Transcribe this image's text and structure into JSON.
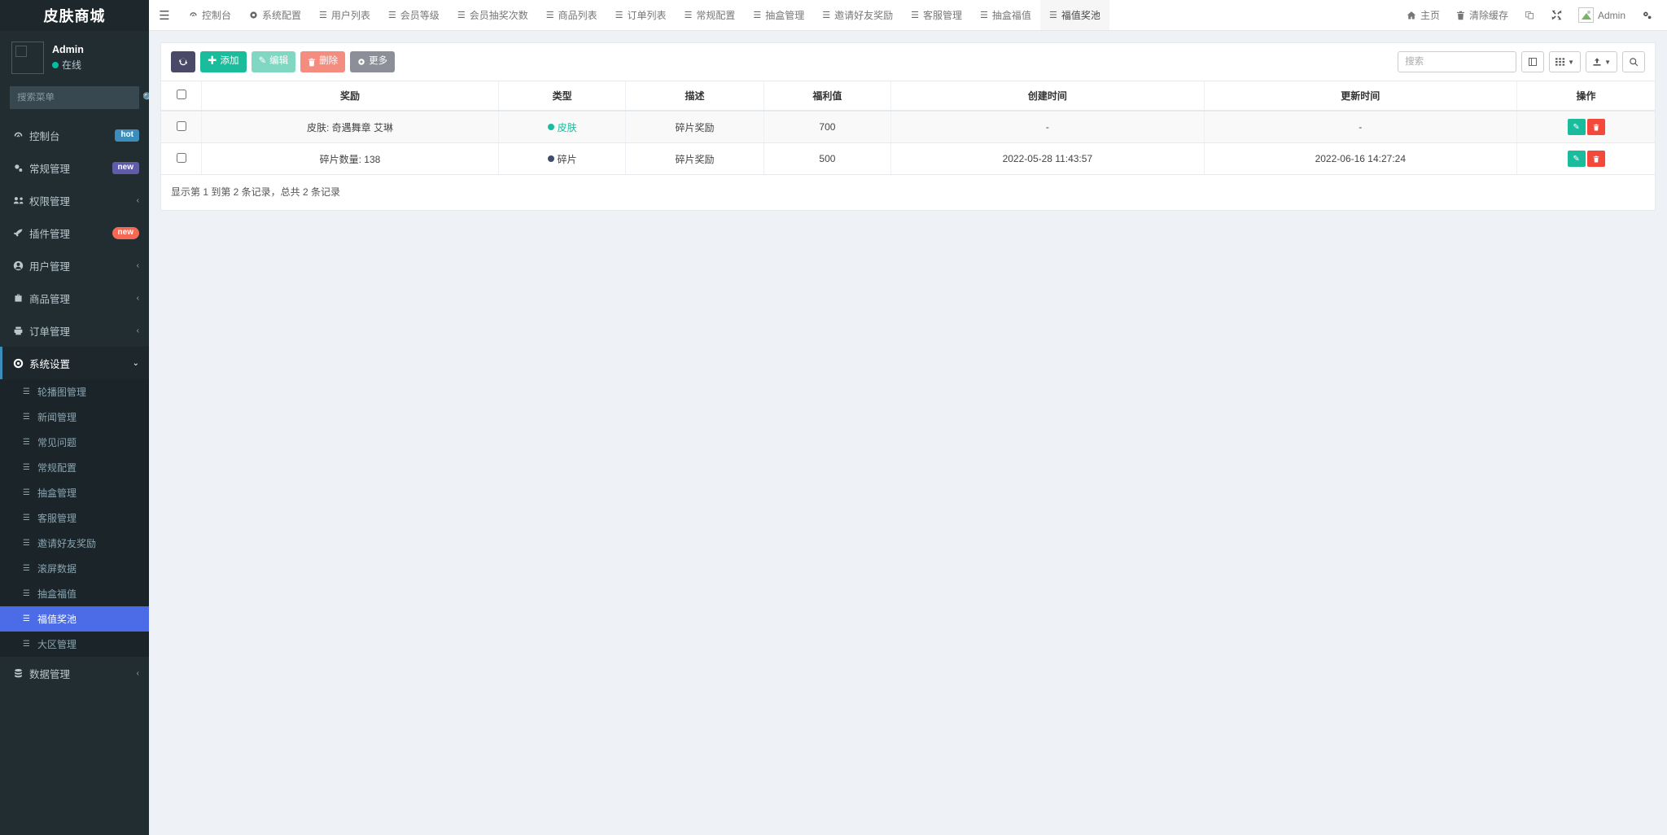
{
  "sidebar": {
    "brand": "皮肤商城",
    "user": {
      "name": "Admin",
      "status": "在线",
      "avatar_icon": "broken-image-placeholder"
    },
    "search": {
      "placeholder": "搜索菜单",
      "value": "",
      "icon": "search-icon"
    },
    "items": [
      {
        "label": "控制台",
        "icon": "dashboard-icon",
        "badge": "hot",
        "badge_type": "hot"
      },
      {
        "label": "常规管理",
        "icon": "cogs-icon",
        "badge": "new",
        "badge_type": "new-purple"
      },
      {
        "label": "权限管理",
        "icon": "users-icon",
        "caret": "‹"
      },
      {
        "label": "插件管理",
        "icon": "rocket-icon",
        "badge": "new",
        "badge_type": "new-red"
      },
      {
        "label": "用户管理",
        "icon": "user-circle-icon",
        "caret": "‹"
      },
      {
        "label": "商品管理",
        "icon": "briefcase-icon",
        "caret": "‹"
      },
      {
        "label": "订单管理",
        "icon": "print-icon",
        "caret": "‹"
      },
      {
        "label": "系统设置",
        "icon": "gear-circle-icon",
        "caret": "⌄",
        "open": true
      },
      {
        "label": "数据管理",
        "icon": "database-icon",
        "caret": "‹"
      }
    ],
    "submenu": [
      {
        "label": "轮播图管理",
        "icon": "list-icon"
      },
      {
        "label": "新闻管理",
        "icon": "list-icon"
      },
      {
        "label": "常见问题",
        "icon": "list-icon"
      },
      {
        "label": "常规配置",
        "icon": "list-icon"
      },
      {
        "label": "抽盒管理",
        "icon": "list-icon"
      },
      {
        "label": "客服管理",
        "icon": "list-icon"
      },
      {
        "label": "邀请好友奖励",
        "icon": "list-icon"
      },
      {
        "label": "滚屏数据",
        "icon": "list-icon"
      },
      {
        "label": "抽盒福值",
        "icon": "list-icon"
      },
      {
        "label": "福值奖池",
        "icon": "list-icon",
        "active": true
      },
      {
        "label": "大区管理",
        "icon": "list-icon"
      }
    ]
  },
  "navbar": {
    "menu_toggle_icon": "hamburger-icon",
    "tabs": [
      {
        "label": "控制台",
        "icon": "dashboard-icon"
      },
      {
        "label": "系统配置",
        "icon": "gear-icon"
      },
      {
        "label": "用户列表",
        "icon": "list-icon"
      },
      {
        "label": "会员等级",
        "icon": "list-icon"
      },
      {
        "label": "会员抽奖次数",
        "icon": "list-icon"
      },
      {
        "label": "商品列表",
        "icon": "list-icon"
      },
      {
        "label": "订单列表",
        "icon": "list-icon"
      },
      {
        "label": "常规配置",
        "icon": "list-icon"
      },
      {
        "label": "抽盒管理",
        "icon": "list-icon"
      },
      {
        "label": "邀请好友奖励",
        "icon": "list-icon"
      },
      {
        "label": "客服管理",
        "icon": "list-icon"
      },
      {
        "label": "抽盒福值",
        "icon": "list-icon"
      },
      {
        "label": "福值奖池",
        "icon": "list-icon",
        "active": true
      }
    ],
    "right": [
      {
        "label": "主页",
        "icon": "home-icon"
      },
      {
        "label": "清除缓存",
        "icon": "trash-icon"
      },
      {
        "label": "",
        "icon": "theme-switch-icon"
      },
      {
        "label": "",
        "icon": "fullscreen-icon"
      },
      {
        "label": "Admin",
        "icon": "avatar-broken-image-icon"
      },
      {
        "label": "",
        "icon": "settings-cogs-icon"
      }
    ]
  },
  "toolbar": {
    "refresh_label": "",
    "refresh_icon": "refresh-icon",
    "add_label": "添加",
    "add_icon": "plus-icon",
    "edit_label": "编辑",
    "edit_icon": "pencil-icon",
    "delete_label": "删除",
    "delete_icon": "trash-icon",
    "more_label": "更多",
    "more_icon": "gear-icon",
    "search_placeholder": "搜索",
    "search_value": "",
    "view_icon": "fullscreen-table-icon",
    "columns_icon": "columns-grid-icon",
    "export_icon": "export-icon",
    "search_button_icon": "search-icon"
  },
  "table": {
    "columns": [
      "",
      "奖励",
      "类型",
      "描述",
      "福利值",
      "创建时间",
      "更新时间",
      "操作"
    ],
    "rows": [
      {
        "reward": "皮肤: 奇遇舞章 艾琳",
        "type": "皮肤",
        "type_color": "#1abc9c",
        "desc": "碎片奖励",
        "benefit": "700",
        "created": "-",
        "updated": "-",
        "edit_icon": "pencil-icon",
        "delete_icon": "trash-icon"
      },
      {
        "reward": "碎片数量: 138",
        "type": "碎片",
        "type_color": "#3f4d6b",
        "desc": "碎片奖励",
        "benefit": "500",
        "created": "2022-05-28 11:43:57",
        "updated": "2022-06-16 14:27:24",
        "edit_icon": "pencil-icon",
        "delete_icon": "trash-icon"
      }
    ],
    "footer": "显示第 1 到第 2 条记录，总共 2 条记录"
  },
  "colors": {
    "sidebar_bg": "#222d32",
    "sidebar_dark": "#1e282c",
    "accent_green": "#1abc9c",
    "accent_blue": "#4b6ce6",
    "danger": "#f4483a",
    "page_bg": "#eef1f5"
  }
}
